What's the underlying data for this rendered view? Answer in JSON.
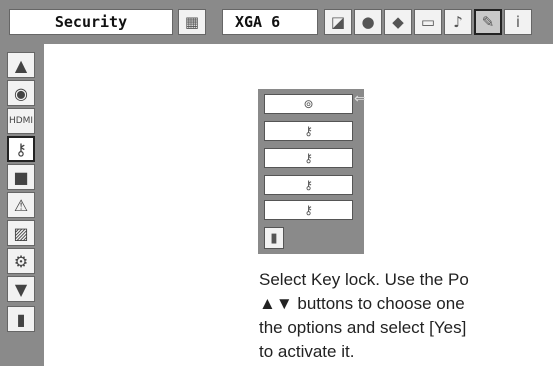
{
  "menu": {
    "title": "Security",
    "signal": "XGA 6",
    "toolbar_icons": [
      "screen-setting-icon",
      "pc-adjust-icon",
      "image-select-icon",
      "image-adjust-icon",
      "screen-icon",
      "sound-icon",
      "setting-icon",
      "information-icon"
    ]
  },
  "sidebar": {
    "icons": [
      "up-arrow-icon",
      "lamp-icon",
      "hdmi-setting-icon",
      "key-lock-icon",
      "screen-icon",
      "warning-icon",
      "pin-code-icon",
      "settings-lock-icon",
      "down-arrow-icon",
      "exit-icon"
    ]
  },
  "submenu": {
    "options": [
      "off-icon",
      "projector-key-icon",
      "remote-key-icon",
      "key-1-icon",
      "key-2-icon"
    ],
    "exit": "exit-icon"
  },
  "instruction": {
    "line1": "Select Key lock. Use the Po",
    "line2": "▲▼ buttons to choose one",
    "line3": "the options and select [Yes]",
    "line4": "to activate it."
  }
}
